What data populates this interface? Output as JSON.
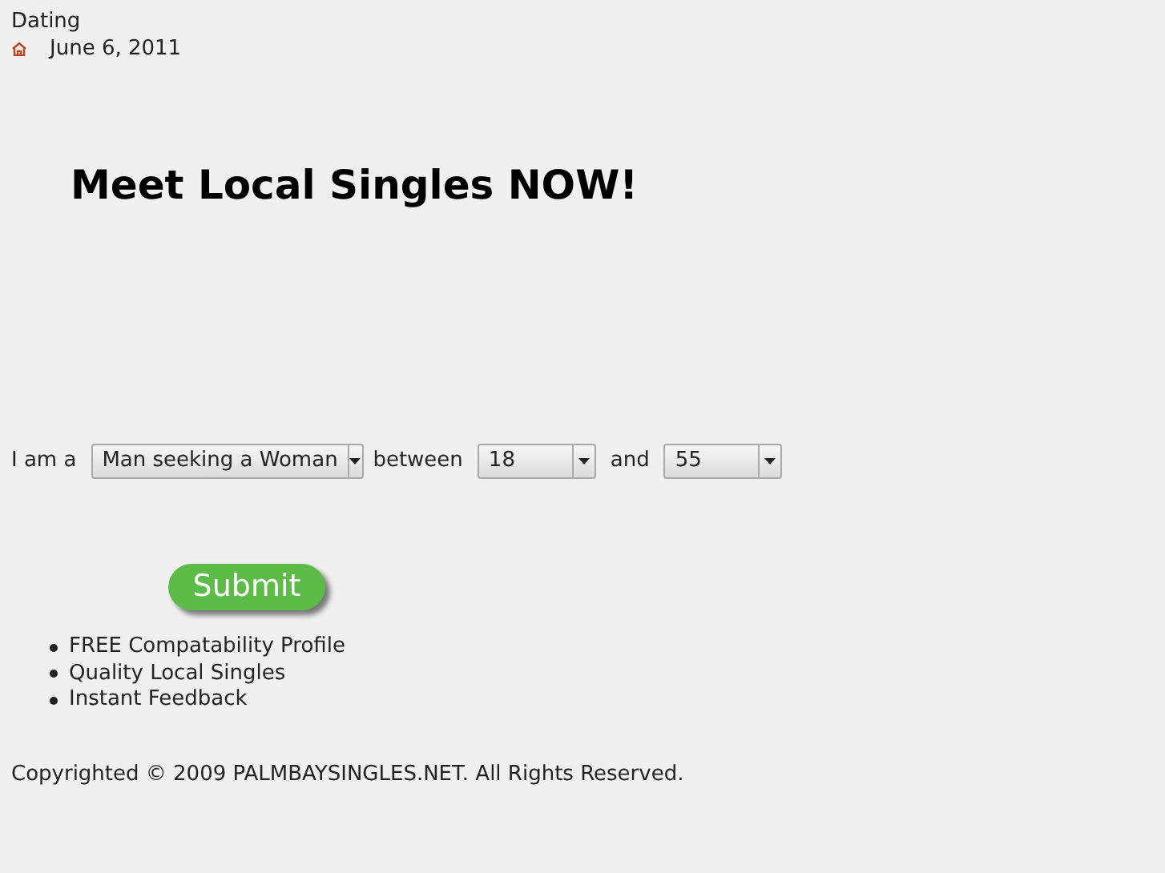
{
  "header": {
    "category": "Dating",
    "date": "June 6, 2011"
  },
  "headline": "Meet Local Singles NOW!",
  "search_form": {
    "label_1": "I am a",
    "seeking": {
      "value": "Man seeking a Woman"
    },
    "label_2": "between",
    "age_min": {
      "value": "18"
    },
    "label_3": "and",
    "age_max": {
      "value": "55"
    },
    "submit": "Submit"
  },
  "features": [
    "FREE Compatability Profile",
    "Quality Local Singles",
    "Instant Feedback"
  ],
  "footer": "Copyrighted © 2009 PALMBAYSINGLES.NET. All Rights Reserved."
}
